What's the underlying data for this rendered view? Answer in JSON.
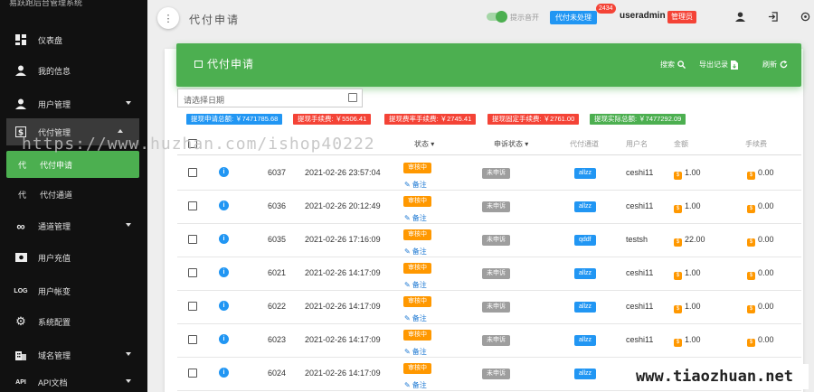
{
  "sidebar": {
    "brand": "易跃跑后台管理系统",
    "items": [
      {
        "label": "仪表盘",
        "icon": "dashboard-icon"
      },
      {
        "label": "我的信息",
        "icon": "user-icon"
      },
      {
        "label": "用户管理",
        "icon": "user-icon"
      },
      {
        "label": "代付管理",
        "icon": "dollar-icon"
      },
      {
        "label": "代付申请",
        "icon": "代"
      },
      {
        "label": "代付通道",
        "icon": "代"
      },
      {
        "label": "通道管理",
        "icon": "infinity-icon"
      },
      {
        "label": "用户充值",
        "icon": "money-icon"
      },
      {
        "label": "用户帐变",
        "icon": "LOG"
      },
      {
        "label": "系统配置",
        "icon": "gear-icon"
      },
      {
        "label": "域名管理",
        "icon": "building-icon"
      },
      {
        "label": "API文档",
        "icon": "API"
      }
    ]
  },
  "topbar": {
    "title": "代付申请",
    "toggle_label": "提示音开",
    "pending_label": "代付未处理",
    "pending_count": "2434",
    "username": "useradmin",
    "role": "管理员"
  },
  "card": {
    "title": "代付申请",
    "search": "搜索",
    "export": "导出记录",
    "refresh": "刷新"
  },
  "filter": {
    "date_placeholder": "请选择日期"
  },
  "stats": [
    {
      "label": "提现申请总额: ￥7471785.68",
      "color": "#2196f3"
    },
    {
      "label": "提现手续费: ￥5506.41",
      "color": "#f44336"
    },
    {
      "label": "提现费率手续费: ￥2745.41",
      "color": "#f44336"
    },
    {
      "label": "提现固定手续费: ￥2761.00",
      "color": "#f44336"
    },
    {
      "label": "提现实际总额: ￥7477292.09",
      "color": "#4caf50"
    }
  ],
  "table": {
    "columns": {
      "status": "状态",
      "appeal": "申诉状态",
      "channel": "代付通道",
      "user": "用户名",
      "amount": "金额",
      "fee": "手续费"
    },
    "remark_label": "备注",
    "rows": [
      {
        "id": "6037",
        "time": "2021-02-26 23:57:04",
        "status": "审核中",
        "appeal": "未申诉",
        "channel": "allzz",
        "user": "ceshi11",
        "amount": "1.00",
        "fee": "0.00"
      },
      {
        "id": "6036",
        "time": "2021-02-26 20:12:49",
        "status": "审核中",
        "appeal": "未申诉",
        "channel": "allzz",
        "user": "ceshi11",
        "amount": "1.00",
        "fee": "0.00"
      },
      {
        "id": "6035",
        "time": "2021-02-26 17:16:09",
        "status": "审核中",
        "appeal": "未申诉",
        "channel": "qddf",
        "user": "testsh",
        "amount": "22.00",
        "fee": "0.00"
      },
      {
        "id": "6021",
        "time": "2021-02-26 14:17:09",
        "status": "审核中",
        "appeal": "未申诉",
        "channel": "allzz",
        "user": "ceshi11",
        "amount": "1.00",
        "fee": "0.00"
      },
      {
        "id": "6022",
        "time": "2021-02-26 14:17:09",
        "status": "审核中",
        "appeal": "未申诉",
        "channel": "allzz",
        "user": "ceshi11",
        "amount": "1.00",
        "fee": "0.00"
      },
      {
        "id": "6023",
        "time": "2021-02-26 14:17:09",
        "status": "审核中",
        "appeal": "未申诉",
        "channel": "allzz",
        "user": "ceshi11",
        "amount": "1.00",
        "fee": "0.00"
      },
      {
        "id": "6024",
        "time": "2021-02-26 14:17:09",
        "status": "审核中",
        "appeal": "未申诉",
        "channel": "allzz",
        "user": "",
        "amount": "",
        "fee": ""
      }
    ]
  },
  "watermarks": {
    "top": "https://www.huzhan.com/ishop40222",
    "bottom": "www.tiaozhuan.net"
  }
}
